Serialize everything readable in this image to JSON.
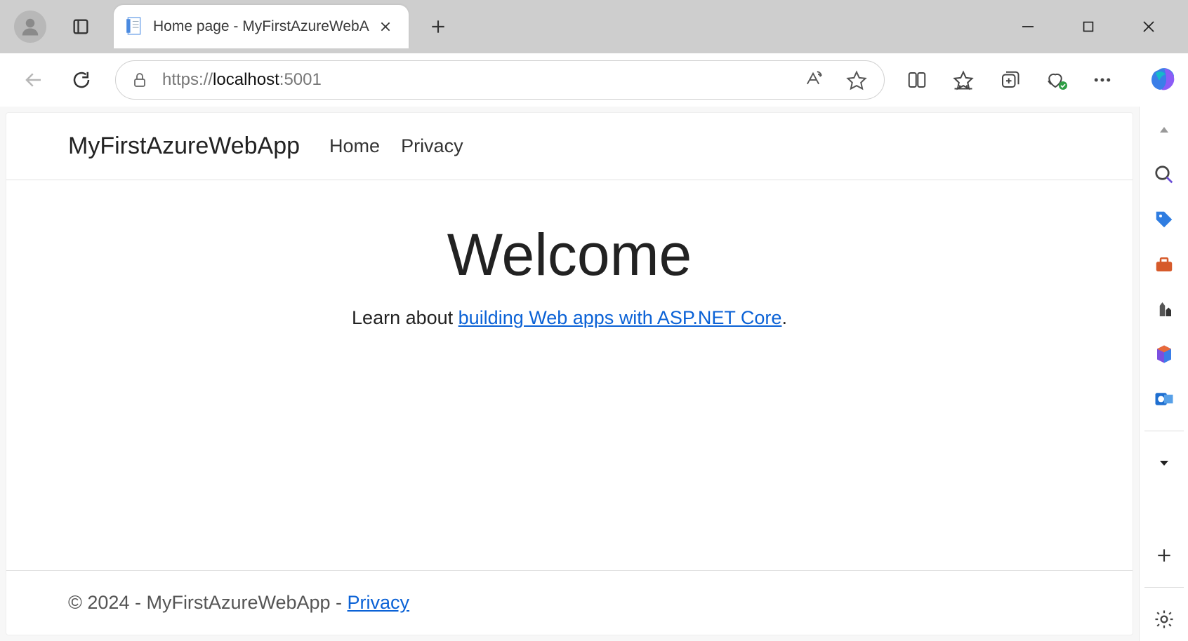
{
  "browser": {
    "tab_title": "Home page - MyFirstAzureWebA",
    "url": {
      "scheme": "https://",
      "host": "localhost",
      "port": ":5001"
    }
  },
  "page": {
    "navbar": {
      "brand": "MyFirstAzureWebApp",
      "links": [
        "Home",
        "Privacy"
      ]
    },
    "hero": {
      "heading": "Welcome",
      "lead_prefix": "Learn about ",
      "lead_link": "building Web apps with ASP.NET Core",
      "lead_suffix": "."
    },
    "footer": {
      "text": "© 2024 - MyFirstAzureWebApp - ",
      "link": "Privacy"
    }
  }
}
